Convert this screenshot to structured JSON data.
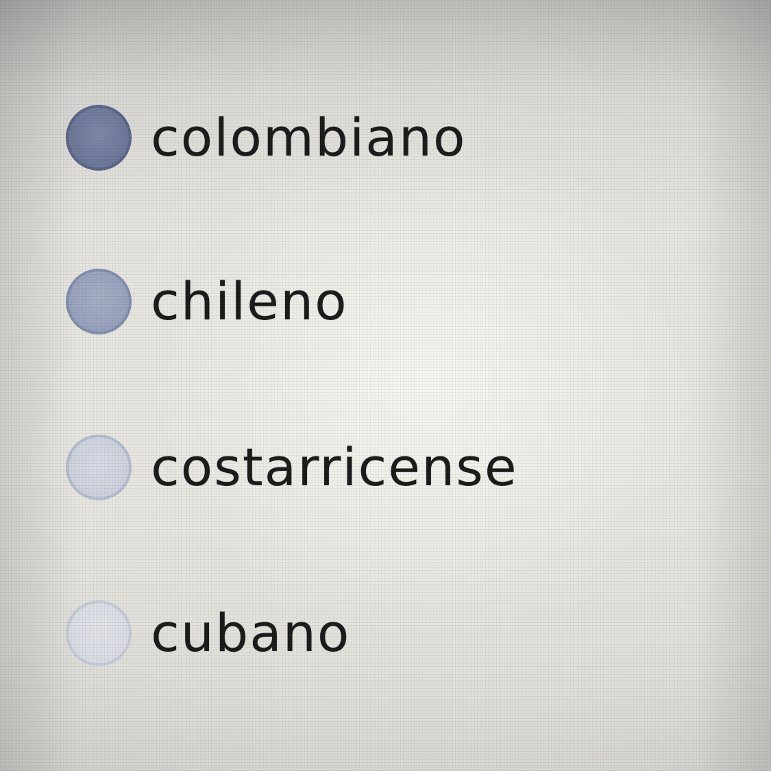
{
  "options": [
    {
      "label": "colombiano",
      "radio_color": "#6c7898"
    },
    {
      "label": "chileno",
      "radio_color": "#98a2bc"
    },
    {
      "label": "costarricense",
      "radio_color": "#cdd2de"
    },
    {
      "label": "cubano",
      "radio_color": "#d9dce4"
    }
  ]
}
